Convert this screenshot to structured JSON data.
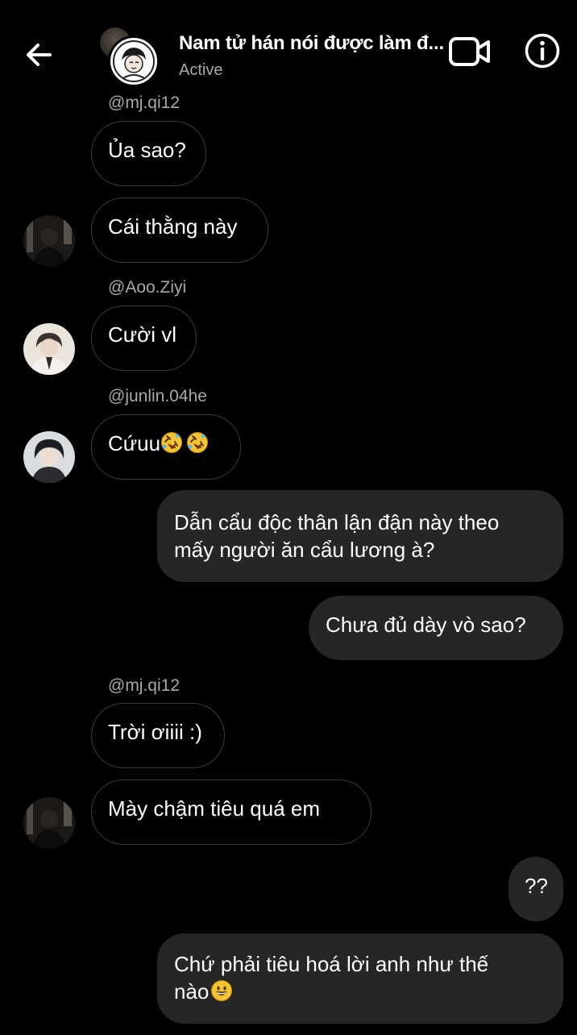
{
  "header": {
    "title": "Nam tử hán nói được làm đ...",
    "status": "Active"
  },
  "messages": [
    {
      "handle": "@mj.qi12"
    },
    {
      "text": "Ủa sao?"
    },
    {
      "text": "Cái thằng này"
    },
    {
      "handle": "@Aoo.Ziyi"
    },
    {
      "text": "Cười vl"
    },
    {
      "handle": "@junlin.04he"
    },
    {
      "text": "Cứuu"
    },
    {
      "line1": "Dẫn cẩu độc thân lận đận này theo",
      "line2": "mấy người ăn cẩu lương à?"
    },
    {
      "text": "Chưa đủ dày vò sao?"
    },
    {
      "handle": "@mj.qi12"
    },
    {
      "text": "Trời ơiiii :)"
    },
    {
      "text": "Mày chậm tiêu quá em"
    },
    {
      "text": "??"
    },
    {
      "line1": "Chứ phải tiêu hoá lời anh như thế",
      "line2": "nào"
    }
  ],
  "icons": {
    "back": "arrow-left-icon",
    "video": "video-camera-icon",
    "info": "info-icon",
    "rofl": "rolling-on-floor-laughing-emoji",
    "grin": "grinning-face-emoji"
  },
  "colors": {
    "background": "#000000",
    "incoming_border": "#3a3a3a",
    "outgoing_bubble": "#262626",
    "secondary_text": "#a8a8a8",
    "emoji_yellow": "#f6c431"
  }
}
